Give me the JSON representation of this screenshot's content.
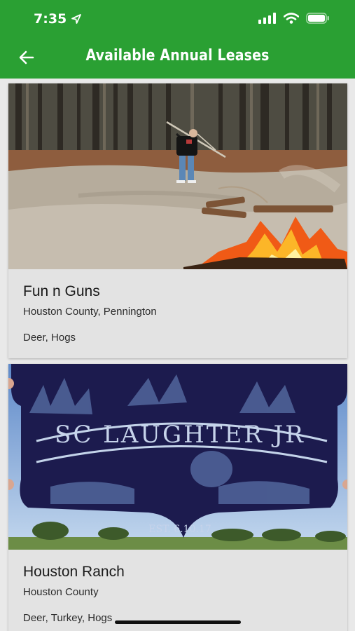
{
  "status_bar": {
    "time": "7:35"
  },
  "header": {
    "title": "Available Annual Leases"
  },
  "leases": [
    {
      "name": "Fun n Guns",
      "location": "Houston County, Pennington",
      "game": "Deer, Hogs",
      "image": "person-throwing-branches-campfire-forest-photo"
    },
    {
      "name": "Houston Ranch",
      "location": "Houston County",
      "game": "Deer, Turkey, Hogs",
      "image": "metal-sign-photo",
      "image_text": "SC LAUGHTER JR EST. 6.10.17"
    }
  ],
  "colors": {
    "header": "#2aa033",
    "background": "#e9e9e9",
    "card": "#e3e3e3",
    "sign": "#1c1b4e"
  }
}
